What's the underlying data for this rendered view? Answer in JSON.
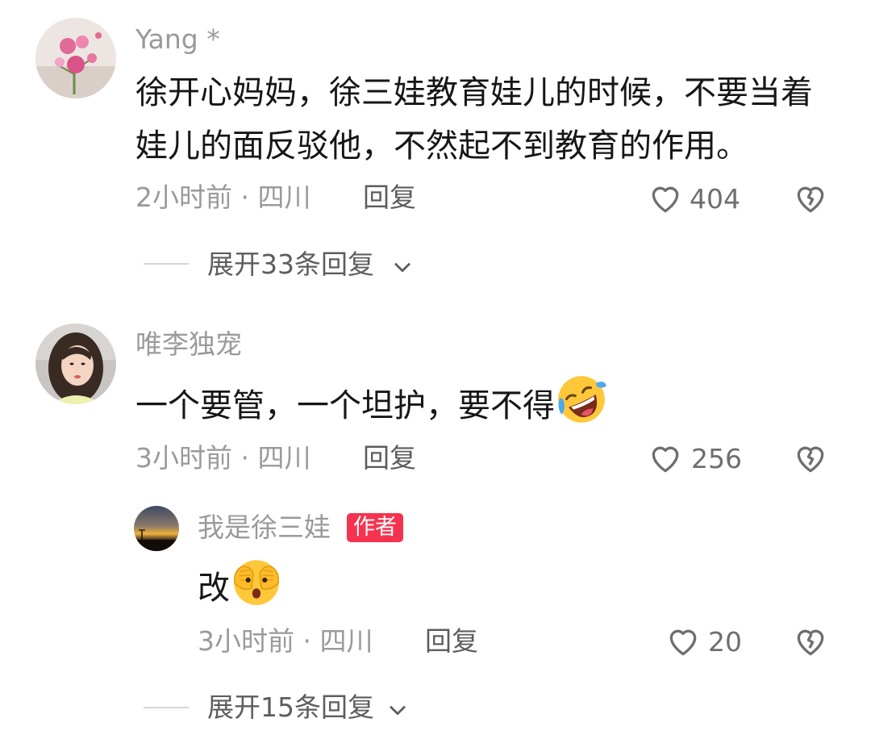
{
  "comments": [
    {
      "username": "Yang *",
      "text_line1": "徐开心妈妈，徐三娃教育娃儿的时候，不要当着",
      "text_line2": "娃儿的面反驳他，不然起不到教育的作用。",
      "time_location": "2小时前 · 四川",
      "reply_label": "回复",
      "likes": "404",
      "expand_label": "展开33条回复"
    },
    {
      "username": "唯李独宠",
      "text": "一个要管，一个坦护，要不得",
      "emoji": "rofl-laughing-emoji",
      "time_location": "3小时前 · 四川",
      "reply_label": "回复",
      "likes": "256",
      "replies": [
        {
          "username": "我是徐三娃",
          "badge": "作者",
          "text": "改",
          "emoji": "covering-eyes-emoji",
          "time_location": "3小时前 · 四川",
          "reply_label": "回复",
          "likes": "20"
        }
      ],
      "expand_label": "展开15条回复"
    }
  ],
  "colors": {
    "badge": "#f6334f",
    "meta": "#9a9a9a",
    "text": "#161616"
  }
}
